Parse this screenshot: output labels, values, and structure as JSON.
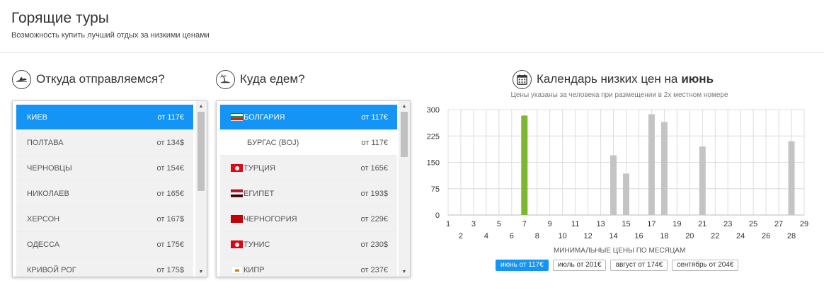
{
  "header": {
    "title": "Горящие туры",
    "subtitle": "Возможность купить лучший отдых за низкими ценами"
  },
  "from": {
    "title": "Откуда отправляемся?",
    "items": [
      {
        "name": "КИЕВ",
        "price": "от 117€",
        "active": true
      },
      {
        "name": "ПОЛТАВА",
        "price": "от 134$"
      },
      {
        "name": "ЧЕРНОВЦЫ",
        "price": "от 154€"
      },
      {
        "name": "НИКОЛАЕВ",
        "price": "от 165€"
      },
      {
        "name": "ХЕРСОН",
        "price": "от 167$"
      },
      {
        "name": "ОДЕССА",
        "price": "от 175€"
      },
      {
        "name": "КРИВОЙ РОГ",
        "price": "от 175$"
      }
    ]
  },
  "to": {
    "title": "Куда едем?",
    "items": [
      {
        "name": "БОЛГАРИЯ",
        "price": "от 117€",
        "flag": "bulgaria",
        "active": true
      },
      {
        "name": "БУРГАС (BOJ)",
        "price": "от 117€",
        "sub": true
      },
      {
        "name": "ТУРЦИЯ",
        "price": "от 165€",
        "flag": "turkey"
      },
      {
        "name": "ЕГИПЕТ",
        "price": "от 193$",
        "flag": "egypt"
      },
      {
        "name": "ЧЕРНОГОРИЯ",
        "price": "от 229€",
        "flag": "montenegro"
      },
      {
        "name": "ТУНИС",
        "price": "от 230$",
        "flag": "tunisia"
      },
      {
        "name": "КИПР",
        "price": "от 237€",
        "flag": "cyprus"
      }
    ]
  },
  "calendar": {
    "title": "Календарь низких цен на",
    "month_bold": "июнь",
    "note": "Цены указаны за человека при размещении в 2х местном номере",
    "months_title": "МИНИМАЛЬНЫЕ ЦЕНЫ ПО МЕСЯЦАМ",
    "months": [
      {
        "label": "июнь от 117€",
        "active": true
      },
      {
        "label": "июль от 201€"
      },
      {
        "label": "август от 174€"
      },
      {
        "label": "сентябрь от 204€"
      }
    ]
  },
  "colors": {
    "accent": "#1494f5",
    "highlight_bar": "#7bb72f",
    "bar": "#c4c4c4"
  },
  "icons": {
    "from": "plane-icon",
    "to": "beach-icon",
    "calendar": "calendar-icon"
  },
  "chart_data": {
    "type": "bar",
    "title": "",
    "xlabel": "",
    "ylabel": "",
    "ylim": [
      0,
      300
    ],
    "yticks": [
      0,
      75,
      150,
      225,
      300
    ],
    "x": [
      1,
      2,
      3,
      4,
      5,
      6,
      7,
      8,
      9,
      10,
      11,
      12,
      13,
      14,
      15,
      16,
      17,
      18,
      19,
      20,
      21,
      22,
      23,
      24,
      25,
      26,
      27,
      28,
      29
    ],
    "values": [
      null,
      null,
      null,
      null,
      null,
      null,
      283,
      null,
      null,
      null,
      null,
      null,
      null,
      170,
      118,
      null,
      287,
      265,
      null,
      null,
      195,
      null,
      null,
      null,
      null,
      null,
      null,
      210,
      null
    ],
    "highlight_x": 7,
    "grid": true
  }
}
